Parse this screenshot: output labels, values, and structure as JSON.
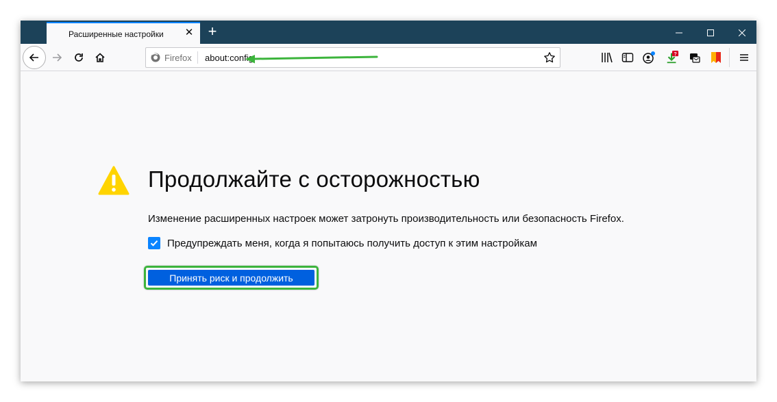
{
  "tab": {
    "title": "Расширенные настройки",
    "close_icon": "close-icon"
  },
  "new_tab_label": "+",
  "urlbar": {
    "identity_label": "Firefox",
    "url": "about:config"
  },
  "content": {
    "title": "Продолжайте с осторожностью",
    "description": "Изменение расширенных настроек может затронуть производительность или безопасность Firefox.",
    "checkbox_label": "Предупреждать меня, когда я попытаюсь получить доступ к этим настройкам",
    "checkbox_checked": true,
    "accept_button": "Принять риск и продолжить"
  },
  "colors": {
    "tabbar_bg": "#1c4259",
    "accent_blue": "#0060df",
    "checkbox_blue": "#0a84ff",
    "annotation_green": "#3cb43c",
    "warning_yellow": "#ffd400"
  },
  "icons": [
    "back-icon",
    "forward-icon",
    "reload-icon",
    "home-icon",
    "firefox-icon",
    "star-icon",
    "library-icon",
    "sidebar-icon",
    "account-icon",
    "download-icon",
    "container-icon",
    "bookmark-flag-icon",
    "menu-icon",
    "warning-icon",
    "checkmark-icon"
  ]
}
